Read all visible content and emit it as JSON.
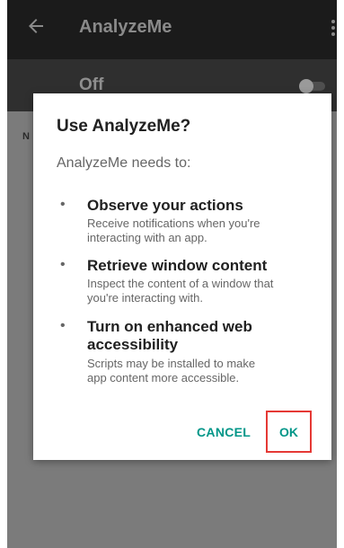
{
  "app": {
    "title": "AnalyzeMe"
  },
  "service": {
    "toggle_label": "Off",
    "toggle_state": "off",
    "background_letter": "N"
  },
  "dialog": {
    "title": "Use AnalyzeMe?",
    "intro": "AnalyzeMe needs to:",
    "bullet": "•",
    "permissions": [
      {
        "title": "Observe your actions",
        "desc_lines": [
          "Receive notifications when you're",
          "interacting with an app."
        ]
      },
      {
        "title": "Retrieve window content",
        "desc_lines": [
          "Inspect the content of a window that",
          "you're interacting with."
        ]
      },
      {
        "title_lines": [
          "Turn on enhanced web",
          "accessibility"
        ],
        "desc_lines": [
          "Scripts may be installed to make",
          "app content more accessible."
        ]
      }
    ],
    "cancel_label": "CANCEL",
    "ok_label": "OK"
  },
  "colors": {
    "accent": "#009688",
    "highlight": "#e53935",
    "appbar": "#1b1b1b",
    "scrim": "#7b7b7b"
  },
  "icons": {
    "back": "arrow-left-icon",
    "overflow": "more-vert-icon"
  }
}
